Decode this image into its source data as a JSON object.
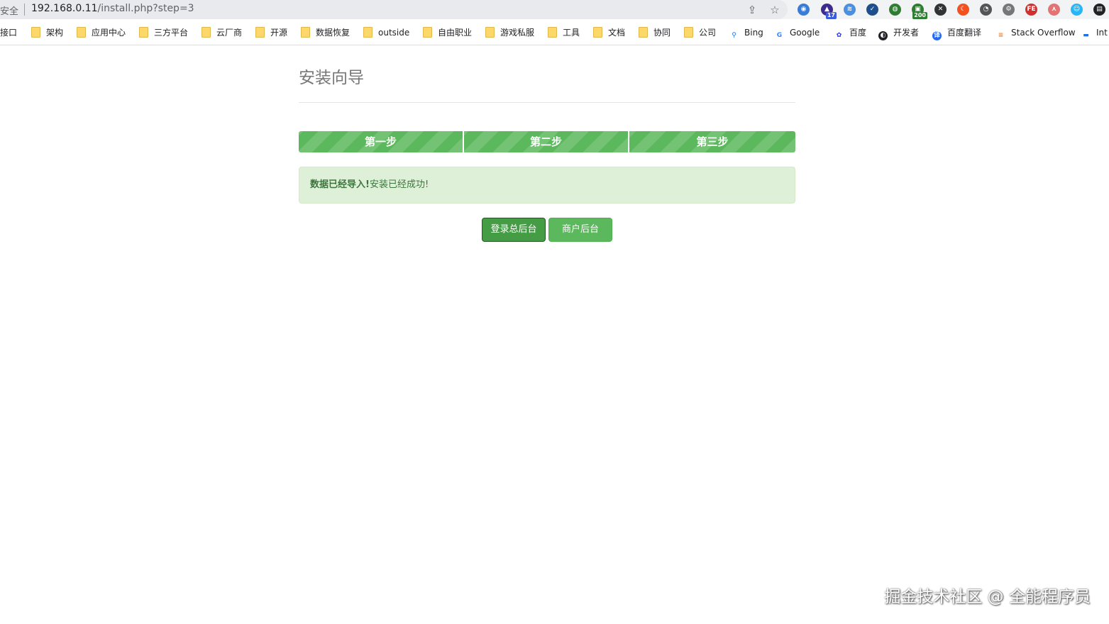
{
  "browser": {
    "security_label": "安全",
    "url_host": "192.168.0.11",
    "url_path": "/install.php?step=3",
    "share_icon": "share-icon",
    "star_icon": "bookmark-star-icon",
    "extensions": [
      {
        "name": "globe-extension-icon",
        "color": "#3a7bd5",
        "glyph": "◉",
        "badge": ""
      },
      {
        "name": "graduation-cap-extension-icon",
        "color": "#3d2c8d",
        "glyph": "▲",
        "badge": "17",
        "badge_color": "#3b5bdb"
      },
      {
        "name": "stack-extension-icon",
        "color": "#4a90e2",
        "glyph": "≋",
        "badge": ""
      },
      {
        "name": "check-circle-extension-icon",
        "color": "#1f4e8c",
        "glyph": "✓",
        "badge": ""
      },
      {
        "name": "earth-extension-icon",
        "color": "#2e7d32",
        "glyph": "◍",
        "badge": ""
      },
      {
        "name": "status-200-extension-icon",
        "color": "#2e7d32",
        "glyph": "▣",
        "badge": "200",
        "badge_color": "#2e7d32"
      },
      {
        "name": "x-extension-icon",
        "color": "#333333",
        "glyph": "✕",
        "badge": ""
      },
      {
        "name": "moon-extension-icon",
        "color": "#f4511e",
        "glyph": "☾",
        "badge": ""
      },
      {
        "name": "speedometer-extension-icon",
        "color": "#555555",
        "glyph": "◔",
        "badge": ""
      },
      {
        "name": "gear-extension-icon",
        "color": "#777777",
        "glyph": "⚙",
        "badge": ""
      },
      {
        "name": "fe-extension-icon",
        "color": "#d32f2f",
        "glyph": "FE",
        "badge": ""
      },
      {
        "name": "tree-extension-icon",
        "color": "#e57373",
        "glyph": "⋏",
        "badge": ""
      },
      {
        "name": "face-extension-icon",
        "color": "#29b6f6",
        "glyph": "☺",
        "badge": ""
      },
      {
        "name": "panel-extension-icon",
        "color": "#222222",
        "glyph": "▤",
        "badge": ""
      }
    ]
  },
  "bookmarks": [
    {
      "label": "接口",
      "icon": "none"
    },
    {
      "label": "架构",
      "icon": "folder-icon"
    },
    {
      "label": "应用中心",
      "icon": "folder-icon"
    },
    {
      "label": "三方平台",
      "icon": "folder-icon"
    },
    {
      "label": "云厂商",
      "icon": "folder-icon"
    },
    {
      "label": "开源",
      "icon": "folder-icon"
    },
    {
      "label": "数据恢复",
      "icon": "folder-icon"
    },
    {
      "label": "outside",
      "icon": "folder-icon"
    },
    {
      "label": "自由职业",
      "icon": "folder-icon"
    },
    {
      "label": "游戏私服",
      "icon": "folder-icon"
    },
    {
      "label": "工具",
      "icon": "folder-icon"
    },
    {
      "label": "文档",
      "icon": "folder-icon"
    },
    {
      "label": "协同",
      "icon": "folder-icon"
    },
    {
      "label": "公司",
      "icon": "folder-icon"
    },
    {
      "label": "Bing",
      "icon": "search-icon"
    },
    {
      "label": "Google",
      "icon": "google-icon"
    },
    {
      "label": "百度",
      "icon": "baidu-paw-icon"
    },
    {
      "label": "开发者",
      "icon": "dev-globe-icon"
    },
    {
      "label": "百度翻译",
      "icon": "translate-icon"
    },
    {
      "label": "Stack Overflow",
      "icon": "stackoverflow-icon"
    },
    {
      "label": "Int",
      "icon": "bar-icon"
    }
  ],
  "page": {
    "title": "安装向导",
    "steps": [
      "第一步",
      "第二步",
      "第三步"
    ],
    "alert_strong": "数据已经导入!",
    "alert_text": "安装已经成功!",
    "buttons": {
      "admin_login": "登录总后台",
      "merchant_backend": "商户后台"
    },
    "watermark": "掘金技术社区 @ 全能程序员"
  },
  "colors": {
    "success_green": "#5cb85c",
    "success_green_dark": "#449d44",
    "alert_bg": "#dff0d8",
    "alert_text": "#3c763d"
  }
}
